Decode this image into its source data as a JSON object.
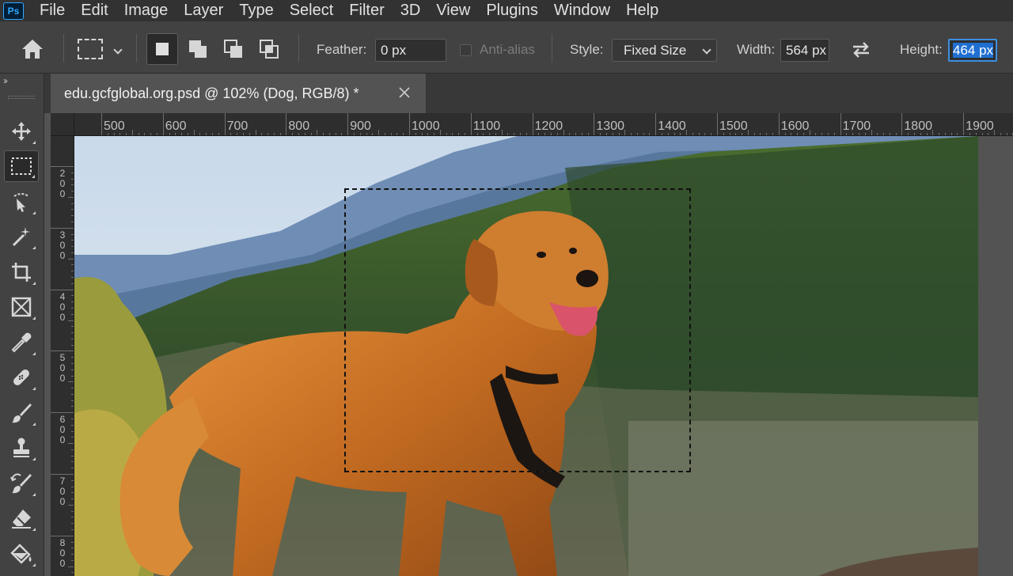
{
  "app": {
    "logo_text": "Ps"
  },
  "menu": [
    "File",
    "Edit",
    "Image",
    "Layer",
    "Type",
    "Select",
    "Filter",
    "3D",
    "View",
    "Plugins",
    "Window",
    "Help"
  ],
  "options": {
    "feather_label": "Feather:",
    "feather_value": "0 px",
    "antialias_label": "Anti-alias",
    "style_label": "Style:",
    "style_value": "Fixed Size",
    "width_label": "Width:",
    "width_value": "564 px",
    "height_label": "Height:",
    "height_value": "464 px"
  },
  "document": {
    "tab_title": "edu.gcfglobal.org.psd @ 102% (Dog, RGB/8) *"
  },
  "rulers": {
    "horizontal": [
      "500",
      "600",
      "700",
      "800",
      "900",
      "1000",
      "1100",
      "1200",
      "1300",
      "1400",
      "1500",
      "1600",
      "1700",
      "1800",
      "1900"
    ],
    "vertical": [
      "200",
      "300",
      "400",
      "500",
      "600",
      "700",
      "800"
    ]
  },
  "tools": [
    "move-icon",
    "rectangular-marquee-icon",
    "object-selection-icon",
    "magic-wand-icon",
    "crop-icon",
    "frame-icon",
    "eyedropper-icon",
    "healing-brush-icon",
    "brush-icon",
    "clone-stamp-icon",
    "history-brush-icon",
    "eraser-icon",
    "paint-bucket-icon"
  ],
  "colors": {
    "accent": "#31a8ff",
    "selection_highlight": "#1f6fd0"
  }
}
